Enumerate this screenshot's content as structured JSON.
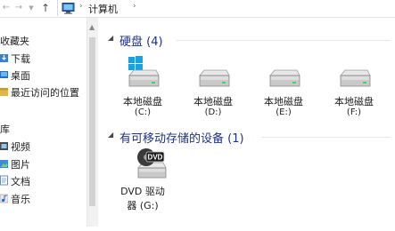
{
  "address": {
    "path": [
      "计算机"
    ]
  },
  "nav": {
    "favorites_heading": "收藏夹",
    "favorites": [
      {
        "label": "下载",
        "icon": "download-folder-icon"
      },
      {
        "label": "桌面",
        "icon": "desktop-folder-icon"
      },
      {
        "label": "最近访问的位置",
        "icon": "recent-places-icon"
      }
    ],
    "libraries_heading": "库",
    "libraries": [
      {
        "label": "视频",
        "icon": "videos-library-icon"
      },
      {
        "label": "图片",
        "icon": "pictures-library-icon"
      },
      {
        "label": "文档",
        "icon": "documents-library-icon"
      },
      {
        "label": "音乐",
        "icon": "music-library-icon"
      }
    ]
  },
  "groups": {
    "hard_disks": {
      "title": "硬盘 (4)",
      "drives": [
        {
          "name": "本地磁盘",
          "letter": "(C:)",
          "icon": "system-drive-icon"
        },
        {
          "name": "本地磁盘",
          "letter": "(D:)",
          "icon": "hard-drive-icon"
        },
        {
          "name": "本地磁盘",
          "letter": "(E:)",
          "icon": "hard-drive-icon"
        },
        {
          "name": "本地磁盘",
          "letter": "(F:)",
          "icon": "hard-drive-icon"
        }
      ]
    },
    "removable": {
      "title": "有可移动存储的设备 (1)",
      "devices": [
        {
          "name_line1": "DVD 驱动",
          "name_line2": "器 (G:)",
          "badge": "DVD",
          "icon": "dvd-drive-icon"
        }
      ]
    }
  },
  "colors": {
    "group_title": "#1e3287",
    "windows_logo": "#1aa1e1"
  }
}
